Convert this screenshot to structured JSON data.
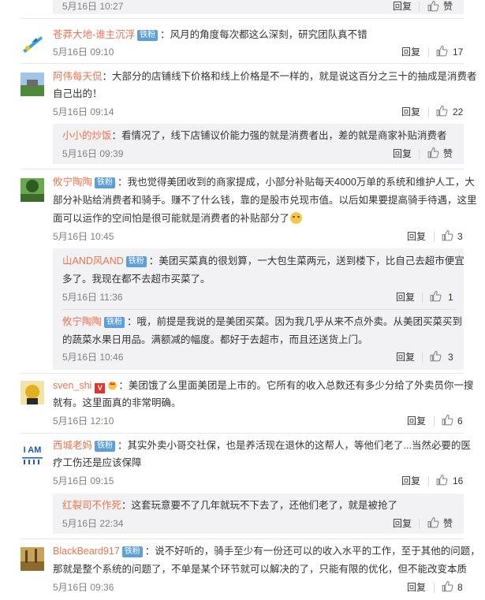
{
  "labels": {
    "reply": "回复",
    "like": "赞"
  },
  "badge_text": "铁粉",
  "top_partial": {
    "time": "5月16日 10:27",
    "like_label": "赞"
  },
  "comments": [
    {
      "user": "苍莽大地-谁主沉浮",
      "text": "：风月的角度每次都这么深刻，研究团队真不错",
      "time": "5月16日 09:10",
      "likes": "17"
    },
    {
      "user": "阿伟每天侃",
      "text1": "：大部分的店铺线下价格和线上价格是不一样的，就是说这百分之三十的抽成是消费者",
      "text2": "自己出的！",
      "time": "5月16日 09:14",
      "likes": "22",
      "sub": [
        {
          "user": "小小的炒饭",
          "text": "：看情况了，线下店铺议价能力强的就是消费者出，差的就是商家补贴消费者",
          "time": "5月16日 09:39",
          "like_label": "赞"
        }
      ]
    },
    {
      "user": "攸宁陶陶",
      "text1": "：我也觉得美团收到的商家提成，小部分补贴每天4000万单的系统和维护人工，大",
      "text2": "部分补贴给消费者和骑手。赚不了什么钱，靠的是股市兑现市值。以后如果要提高骑手待遇，这里",
      "text3": "面可以运作的空间怕是很可能就是消费者的补贴部分了",
      "time": "5月16日 10:45",
      "likes": "3",
      "sub": [
        {
          "user": "山AND风AND",
          "text1": "：美团买菜真的很划算，一大包生菜两元，送到楼下，比自己去超市便宜",
          "text2": "多了。我现在都不去超市买菜了。",
          "time": "5月16日 11:36",
          "likes": "1"
        },
        {
          "user": "攸宁陶陶",
          "text1": "：哦，前提是我说的是美团买菜。因为我几乎从来不点外卖。从美团买菜买到",
          "text2": "的蔬菜水果日用品。满额减的幅度。都好于去超市，而且还送货上门。",
          "time": "5月16日 10:46",
          "likes": "3"
        }
      ]
    },
    {
      "user": "sven_shi",
      "v": "V",
      "text1": "：美团饿了么里面美团是上市的。它所有的收入总数还有多少分给了外卖员你一搜",
      "text2": "就有。这里面真的非常明确。",
      "time": "5月16日 12:10",
      "likes": "6"
    },
    {
      "user": "西城老妈",
      "text1": "：其实外卖小哥交社保，也是养活现在退休的这帮人，等他们老了...当然必要的医",
      "text2": "疗工伤还是应该保障",
      "time": "5月16日 09:15",
      "likes": "16",
      "avatar_text": "I AM",
      "sub": [
        {
          "user": "红裂司不作死",
          "text": "：这套玩意要不了几年就玩不下去了，还他们老了，就是被抢了",
          "time": "5月16日 22:34",
          "like_label": "赞"
        }
      ]
    },
    {
      "user": "BlackBeard917",
      "text1": "：说不好听的，骑手至少有一份还可以的收入水平的工作，至于其他的问题，",
      "text2": "那就是整个系统的问题了，不单是某个环节就可以解决的了，只能有限的优化，但不能改变本质",
      "time": "5月16日 09:36",
      "likes": "8"
    }
  ]
}
